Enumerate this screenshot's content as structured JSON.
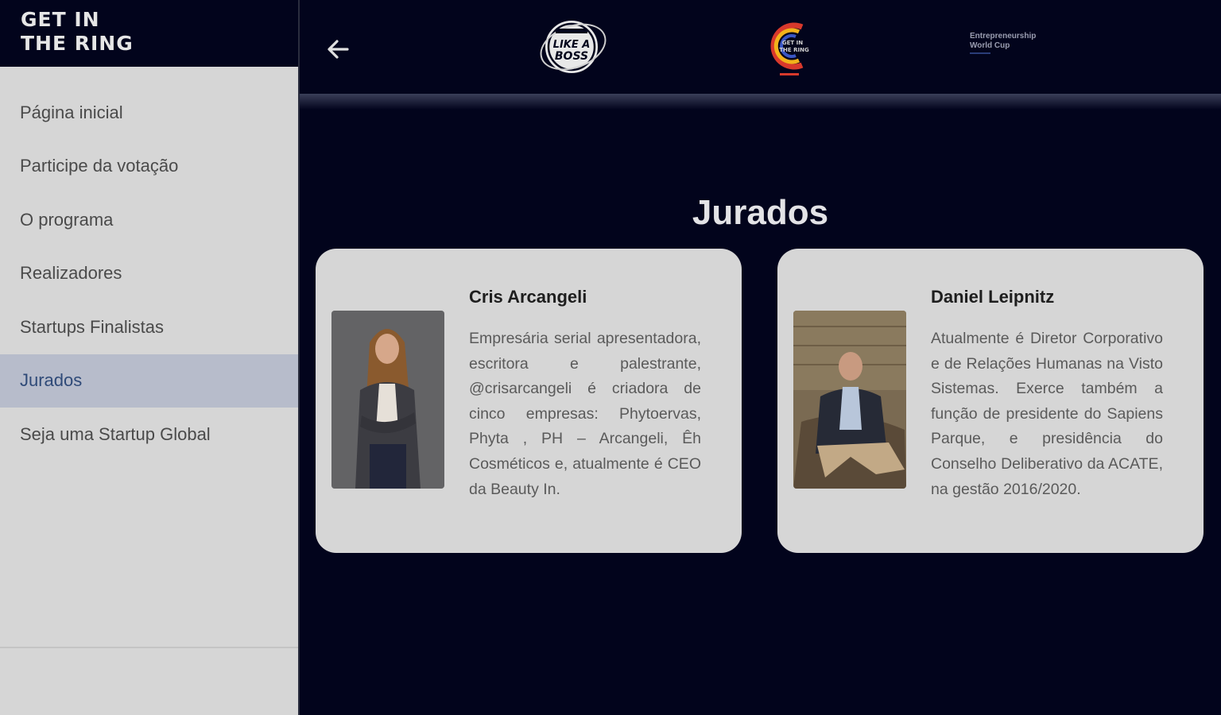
{
  "brand": {
    "line1": "GET IN",
    "line2": "THE RING"
  },
  "sidebar": {
    "items": [
      {
        "label": "Página inicial",
        "active": false
      },
      {
        "label": "Participe da votação",
        "active": false
      },
      {
        "label": "O programa",
        "active": false
      },
      {
        "label": "Realizadores",
        "active": false
      },
      {
        "label": "Startups Finalistas",
        "active": false
      },
      {
        "label": "Jurados",
        "active": true
      },
      {
        "label": "Seja uma Startup Global",
        "active": false
      }
    ]
  },
  "header": {
    "back_icon": "arrow-left-icon",
    "logo1_text": "LIKE A BOSS",
    "logo2_text": "GET IN THE RING",
    "logo3_line1": "Entrepreneurship",
    "logo3_line2": "World Cup"
  },
  "main": {
    "title": "Jurados",
    "judges": [
      {
        "name": "Cris Arcangeli",
        "bio": "Empresária serial apresentadora, escritora e palestrante, @crisarcangeli é criadora de cinco empresas: Phytoervas, Phyta , PH – Arcangeli, Êh Cosméticos e, atualmente é CEO da Beauty In."
      },
      {
        "name": "Daniel Leipnitz",
        "bio": "Atualmente é Diretor Corporativo e de Relações Humanas na Visto Sistemas. Exerce também a função de presidente do Sapiens Parque, e presidência do Conselho Deliberativo da ACATE, na gestão 2016/2020."
      }
    ]
  },
  "colors": {
    "background": "#02041c",
    "sidebar": "#d6d6d6",
    "active_item": "#b7bccb",
    "active_text": "#2f4a78",
    "card": "#d6d6d6"
  }
}
